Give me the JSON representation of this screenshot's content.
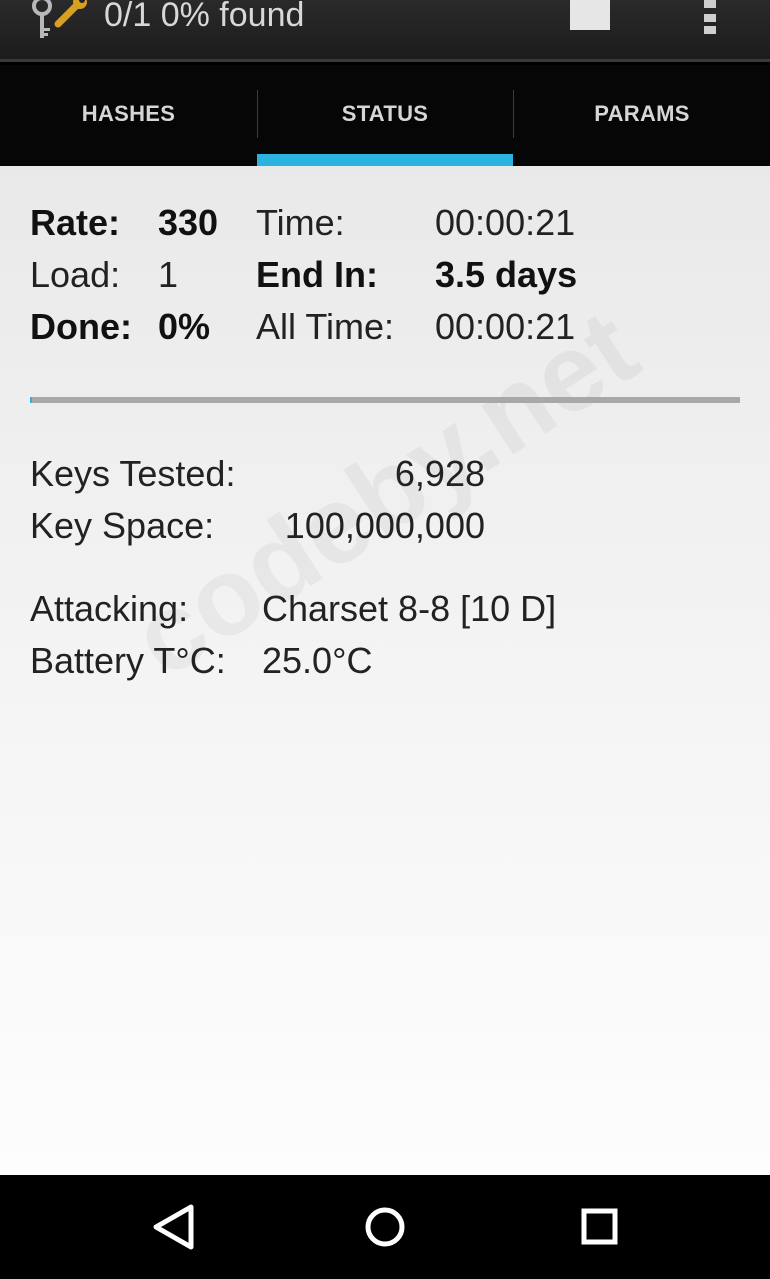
{
  "actionbar": {
    "title": "0/1 0% found",
    "icons": {
      "app": "keys-wrench-icon",
      "stop": "stop-square-icon",
      "overflow": "overflow-menu-icon"
    }
  },
  "tabs": [
    {
      "label": "HASHES",
      "selected": false
    },
    {
      "label": "STATUS",
      "selected": true
    },
    {
      "label": "PARAMS",
      "selected": false
    }
  ],
  "status": {
    "rate_label": "Rate:",
    "rate_value": "330",
    "time_label": "Time:",
    "time_value": "00:00:21",
    "load_label": "Load:",
    "load_value": "1",
    "endin_label": "End In:",
    "endin_value": "3.5 days",
    "done_label": "Done:",
    "done_value": "0%",
    "alltime_label": "All Time:",
    "alltime_value": "00:00:21",
    "progress_percent": 0,
    "keys_tested_label": "Keys Tested:",
    "keys_tested_value": "6,928",
    "key_space_label": "Key Space:",
    "key_space_value": "100,000,000",
    "attacking_label": "Attacking:",
    "attacking_value": "Charset 8-8 [10 D]",
    "battery_label": "Battery T°C:",
    "battery_value": "25.0°C"
  },
  "watermark": "codeby.net",
  "navbar": {
    "back": "back-triangle-icon",
    "home": "home-circle-icon",
    "recents": "recents-square-icon"
  },
  "colors": {
    "accent": "#2ab3e0",
    "actionbar": "#222222",
    "tabbar": "#060606",
    "content": "#f0f0f0"
  }
}
